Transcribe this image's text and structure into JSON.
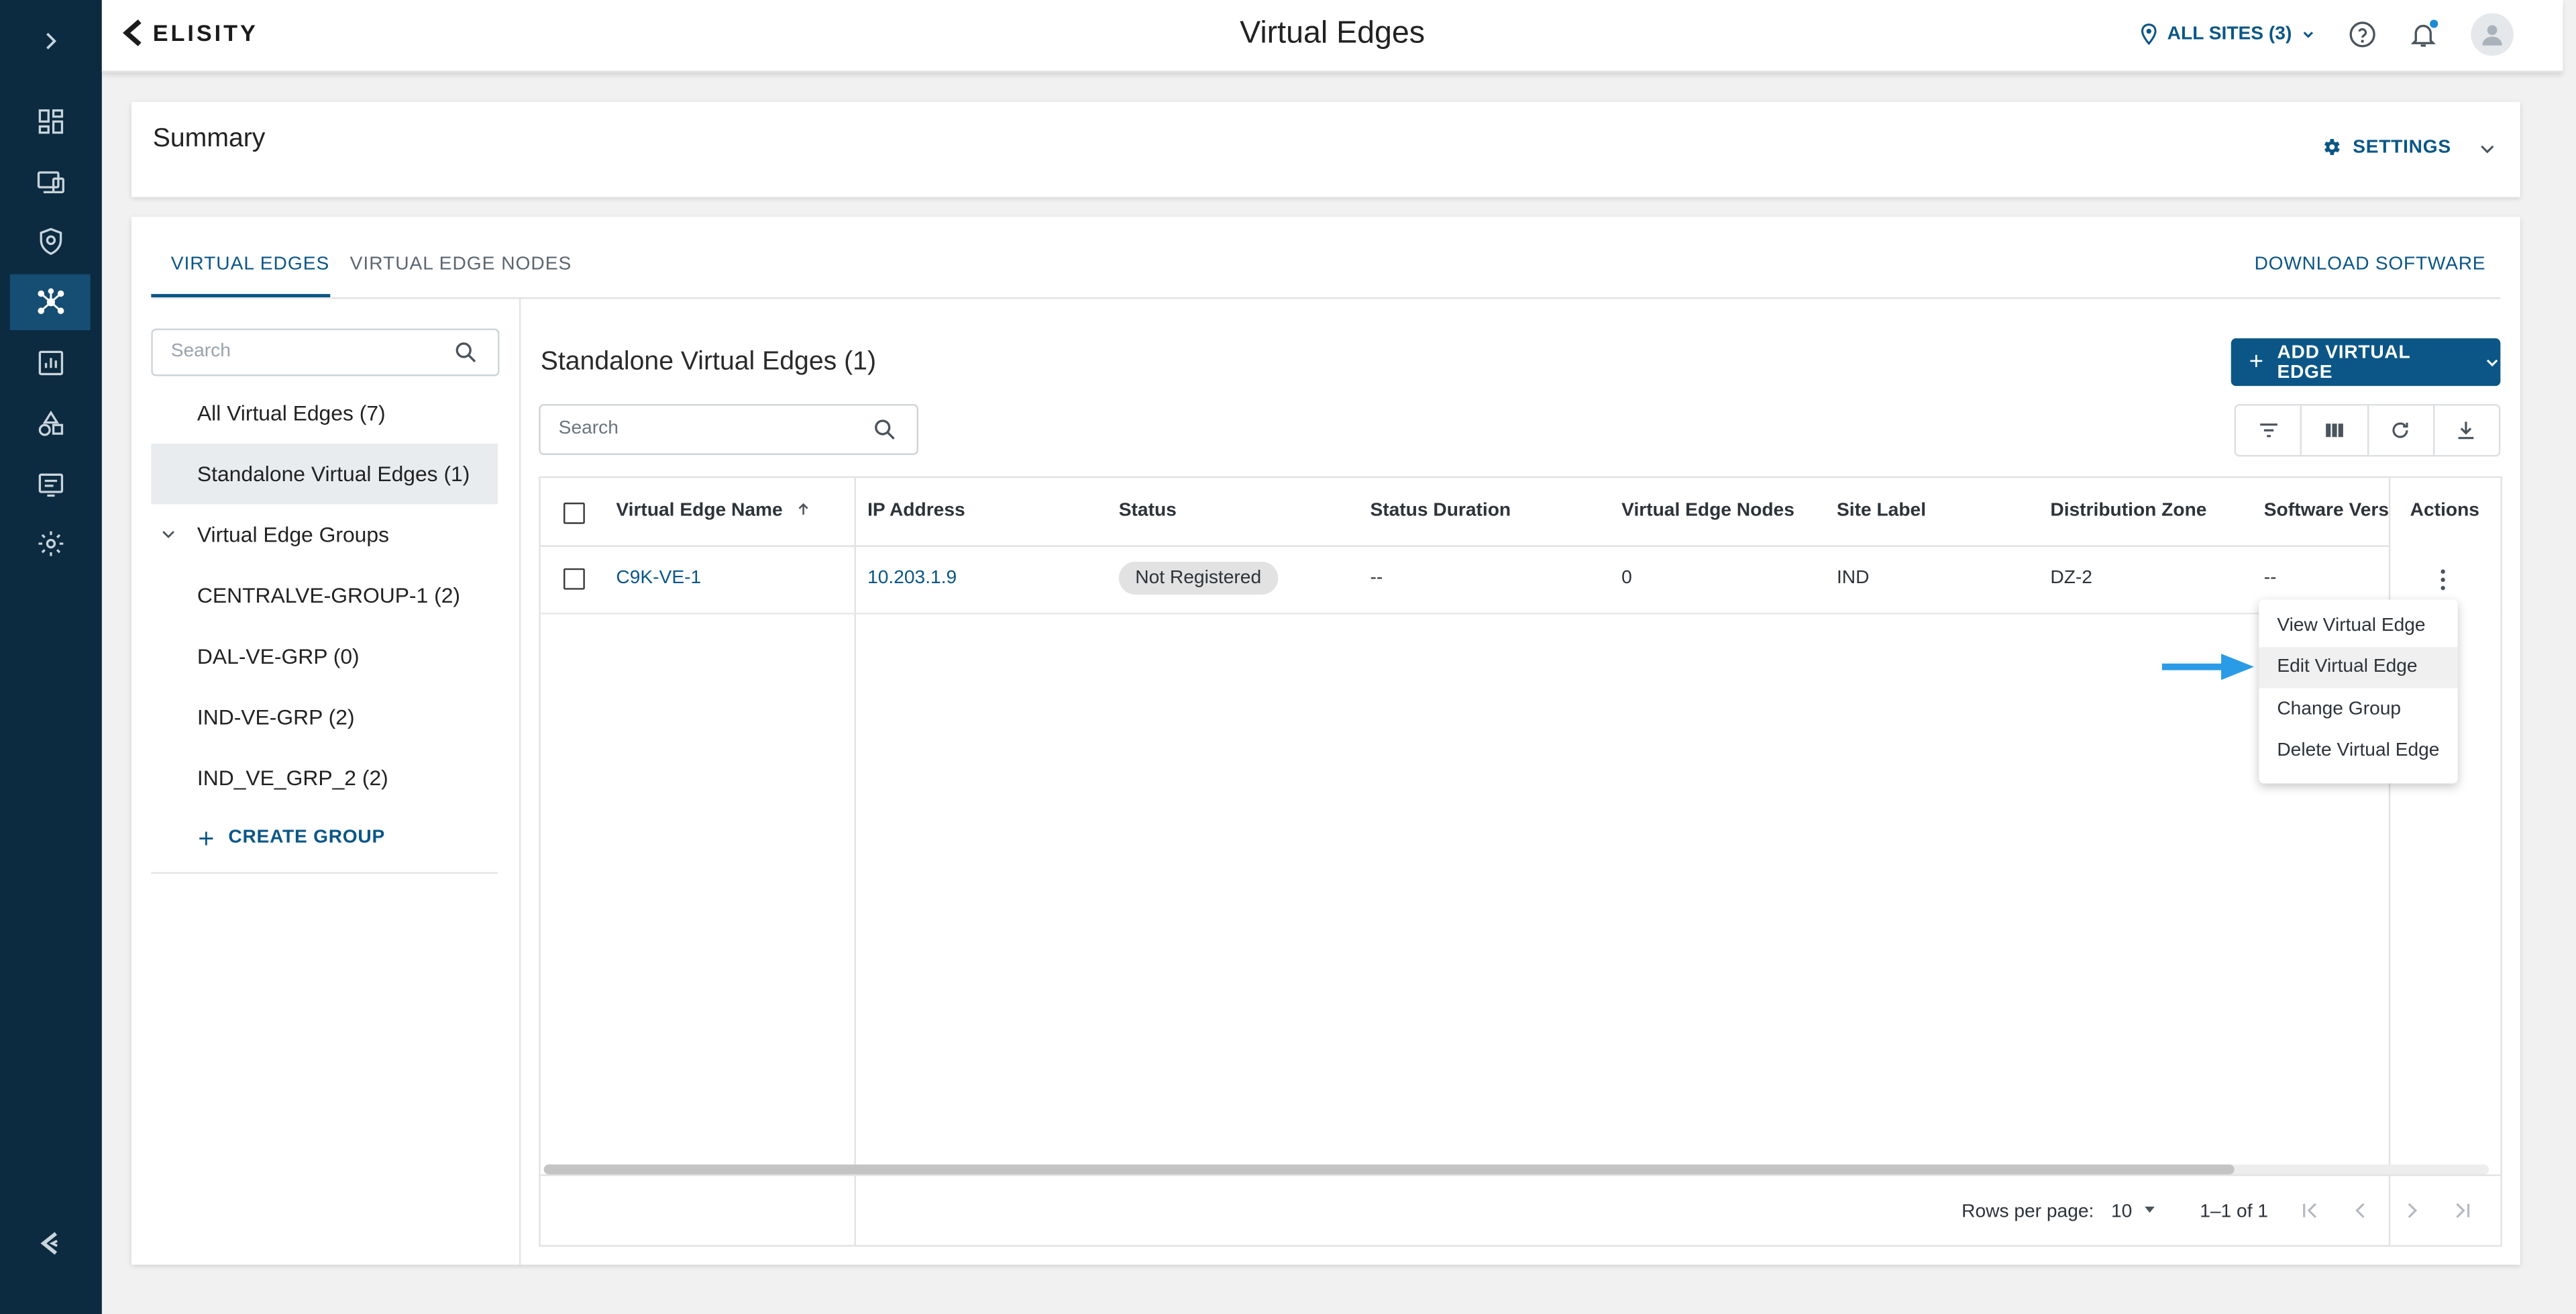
{
  "brand": {
    "name": "ELISITY",
    "accent": "#0b5686",
    "sidebar_bg": "#0c2b40"
  },
  "sidebar": {
    "items": [
      {
        "icon": "chevron-right-icon"
      },
      {
        "icon": "dashboard-icon"
      },
      {
        "icon": "devices-icon"
      },
      {
        "icon": "policy-shield-icon"
      },
      {
        "icon": "network-hub-icon",
        "active": true
      },
      {
        "icon": "analytics-icon"
      },
      {
        "icon": "shapes-icon"
      },
      {
        "icon": "logs-icon"
      },
      {
        "icon": "settings-gear-icon"
      }
    ],
    "footer_icon": "elisity-logo-icon"
  },
  "header": {
    "title": "Virtual Edges",
    "sites_label": "ALL SITES (3)"
  },
  "summary": {
    "title": "Summary",
    "settings_label": "SETTINGS"
  },
  "tabs": [
    {
      "label": "VIRTUAL EDGES",
      "active": true
    },
    {
      "label": "VIRTUAL EDGE NODES",
      "active": false
    }
  ],
  "download_label": "DOWNLOAD SOFTWARE",
  "left_panel": {
    "search_placeholder": "Search",
    "items": [
      {
        "label": "All Virtual Edges (7)"
      },
      {
        "label": "Standalone Virtual Edges (1)",
        "selected": true
      },
      {
        "label": "Virtual Edge Groups",
        "expandable": true
      },
      {
        "label": "CENTRALVE-GROUP-1 (2)"
      },
      {
        "label": "DAL-VE-GRP (0)"
      },
      {
        "label": "IND-VE-GRP (2)"
      },
      {
        "label": "IND_VE_GRP_2 (2)"
      }
    ],
    "create_group_label": "CREATE GROUP"
  },
  "content": {
    "title": "Standalone Virtual Edges (1)",
    "add_button_label": "ADD VIRTUAL EDGE",
    "search_placeholder": "Search",
    "columns": [
      "Virtual Edge Name",
      "IP Address",
      "Status",
      "Status Duration",
      "Virtual Edge Nodes",
      "Site Label",
      "Distribution Zone",
      "Software Versi",
      "Actions"
    ],
    "rows": [
      {
        "name": "C9K-VE-1",
        "ip": "10.203.1.9",
        "status": "Not Registered",
        "status_duration": "--",
        "nodes": "0",
        "site_label": "IND",
        "zone": "DZ-2",
        "software": "--"
      }
    ],
    "pagination": {
      "rows_per_page_label": "Rows per page:",
      "rows_per_page": "10",
      "range": "1–1 of 1"
    }
  },
  "context_menu": {
    "items": [
      "View Virtual Edge",
      "Edit Virtual Edge",
      "Change Group",
      "Delete Virtual Edge"
    ],
    "highlighted": "Edit Virtual Edge",
    "pointer_color": "#2a9be6"
  }
}
